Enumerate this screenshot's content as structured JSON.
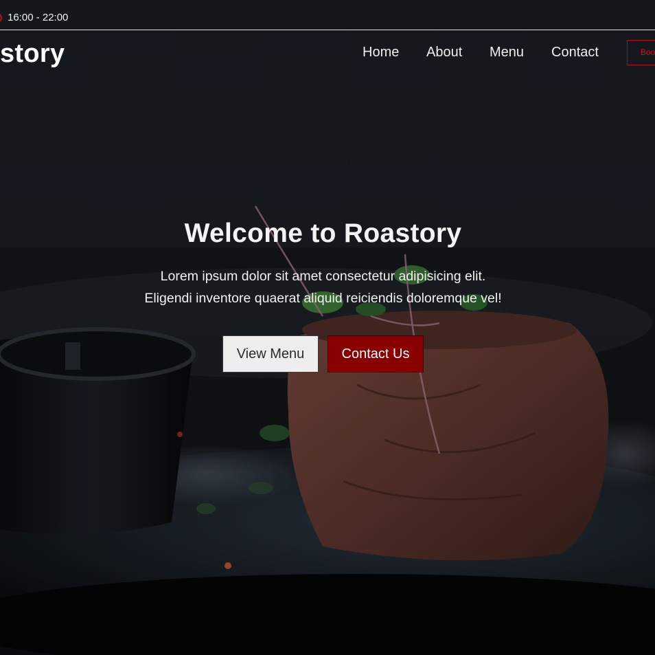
{
  "topbar": {
    "hours": "16:00 - 22:00",
    "icon": "clock-icon"
  },
  "header": {
    "logo": "story",
    "nav": [
      {
        "label": "Home"
      },
      {
        "label": "About"
      },
      {
        "label": "Menu"
      },
      {
        "label": "Contact"
      }
    ],
    "book_label": "Boo"
  },
  "hero": {
    "title": "Welcome to Roastory",
    "subtitle_line1": "Lorem ipsum dolor sit amet consectetur adipisicing elit.",
    "subtitle_line2": "Eligendi inventore quaerat aliquid reiciendis doloremque vel!",
    "view_menu_label": "View Menu",
    "contact_label": "Contact Us"
  },
  "colors": {
    "accent_red": "#8a0000",
    "outline_red": "#b4101a",
    "background": "#1a1d24"
  }
}
